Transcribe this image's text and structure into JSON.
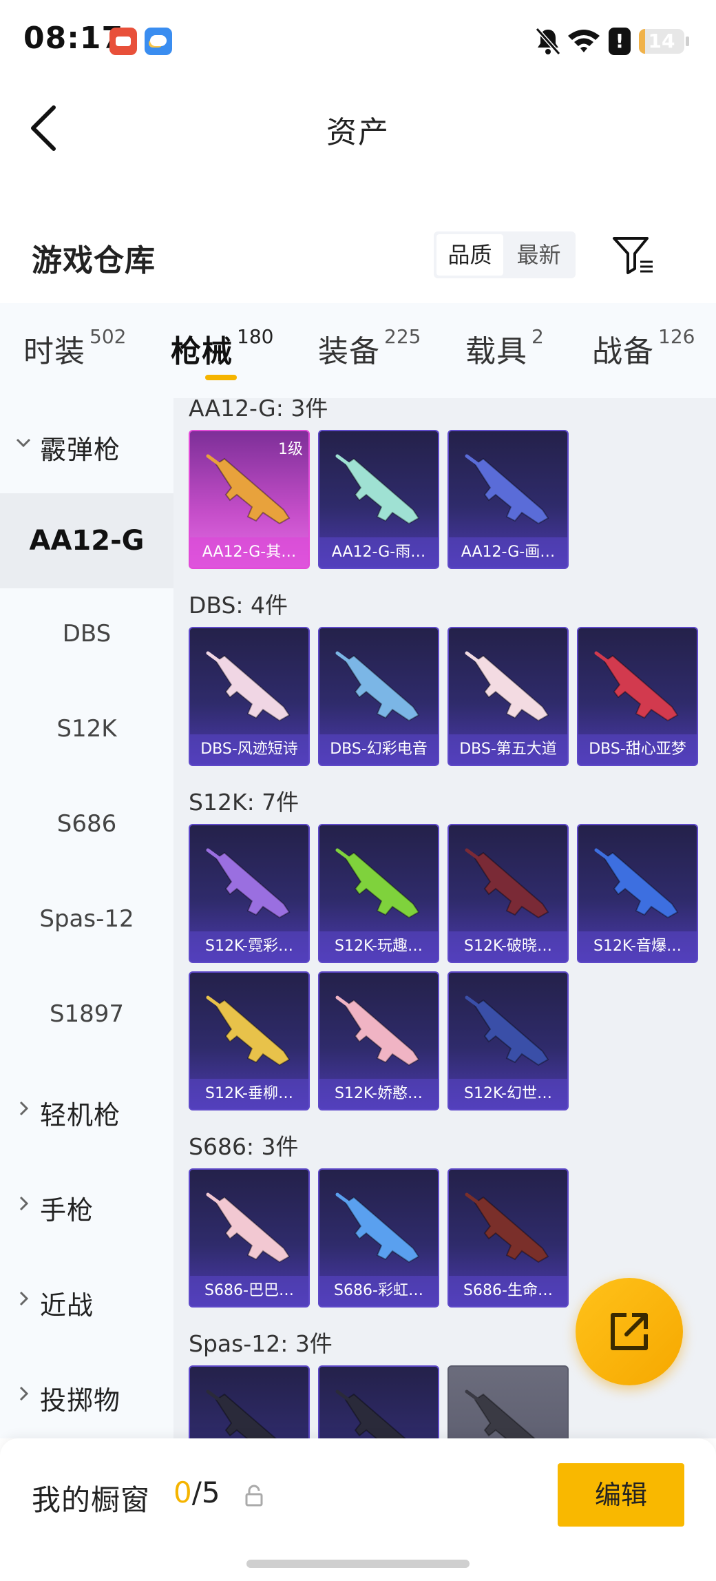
{
  "status_bar": {
    "time": "08:17",
    "battery": "14",
    "battery_level": 0.14,
    "alert_glyph": "!",
    "icons": [
      "app-video-icon",
      "weather-icon",
      "bell-off-icon",
      "wifi-icon",
      "alert-icon",
      "battery-icon"
    ]
  },
  "header": {
    "title": "资产",
    "back_icon": "chevron-left-icon"
  },
  "section": {
    "title": "游戏仓库",
    "sort_options": [
      "品质",
      "最新"
    ],
    "selected_sort": "品质",
    "filter_icon": "filter-icon"
  },
  "tabs": [
    {
      "label": "时装",
      "count": "502",
      "active": false
    },
    {
      "label": "枪械",
      "count": "180",
      "active": true
    },
    {
      "label": "装备",
      "count": "225",
      "active": false
    },
    {
      "label": "载具",
      "count": "2",
      "active": false
    },
    {
      "label": "战备",
      "count": "126",
      "active": false
    }
  ],
  "sidebar": {
    "items": [
      {
        "label": "霰弹枪",
        "type": "group",
        "expanded": true
      },
      {
        "label": "AA12-G",
        "type": "sub",
        "selected": true
      },
      {
        "label": "DBS",
        "type": "sub"
      },
      {
        "label": "S12K",
        "type": "sub"
      },
      {
        "label": "S686",
        "type": "sub"
      },
      {
        "label": "Spas-12",
        "type": "sub"
      },
      {
        "label": "S1897",
        "type": "sub"
      },
      {
        "label": "轻机枪",
        "type": "group",
        "expanded": false
      },
      {
        "label": "手枪",
        "type": "group",
        "expanded": false
      },
      {
        "label": "近战",
        "type": "group",
        "expanded": false
      },
      {
        "label": "投掷物",
        "type": "group",
        "expanded": false
      }
    ]
  },
  "groups": [
    {
      "title": "AA12-G: 3件",
      "items": [
        {
          "name": "AA12-G-其…",
          "level": "1级",
          "style": "pink",
          "color": "#e8a23c"
        },
        {
          "name": "AA12-G-雨…",
          "style": "purple",
          "color": "#9fe1d3"
        },
        {
          "name": "AA12-G-画…",
          "style": "purple",
          "color": "#5a6cd8"
        }
      ]
    },
    {
      "title": "DBS: 4件",
      "items": [
        {
          "name": "DBS-风迹短诗",
          "style": "purple",
          "color": "#f0d6e4"
        },
        {
          "name": "DBS-幻彩电音",
          "style": "purple",
          "color": "#7bb6e6"
        },
        {
          "name": "DBS-第五大道",
          "style": "purple",
          "color": "#f3dbe2"
        },
        {
          "name": "DBS-甜心亚梦",
          "style": "purple",
          "color": "#d23a4e"
        }
      ]
    },
    {
      "title": "S12K: 7件",
      "items": [
        {
          "name": "S12K-霓彩…",
          "style": "purple",
          "color": "#9a6fe0"
        },
        {
          "name": "S12K-玩趣…",
          "style": "purple",
          "color": "#7fd23c"
        },
        {
          "name": "S12K-破晓…",
          "style": "purple",
          "color": "#7a2a36"
        },
        {
          "name": "S12K-音爆…",
          "style": "purple",
          "color": "#3d6fe0"
        },
        {
          "name": "S12K-垂柳…",
          "style": "purple",
          "color": "#e8c24a"
        },
        {
          "name": "S12K-娇憨…",
          "style": "purple",
          "color": "#f0b4c4"
        },
        {
          "name": "S12K-幻世…",
          "style": "purple",
          "color": "#3a4fa8"
        }
      ]
    },
    {
      "title": "S686: 3件",
      "items": [
        {
          "name": "S686-巴巴…",
          "style": "purple",
          "color": "#f2c8d2"
        },
        {
          "name": "S686-彩虹…",
          "style": "purple",
          "color": "#5aa0ef"
        },
        {
          "name": "S686-生命…",
          "style": "purple",
          "color": "#7a2f2a"
        }
      ]
    },
    {
      "title": "Spas-12: 3件",
      "items": [
        {
          "name": "",
          "style": "purple",
          "color": "#2a2a3a"
        },
        {
          "name": "",
          "style": "purple",
          "color": "#2a2a3a"
        },
        {
          "name": "",
          "style": "gray",
          "color": "#3a3a44"
        }
      ]
    }
  ],
  "fab": {
    "icon": "share-external-icon"
  },
  "showcase": {
    "label": "我的橱窗",
    "current": "0",
    "separator": "/",
    "total": "5",
    "lock_icon": "lock-icon",
    "edit_label": "编辑"
  }
}
